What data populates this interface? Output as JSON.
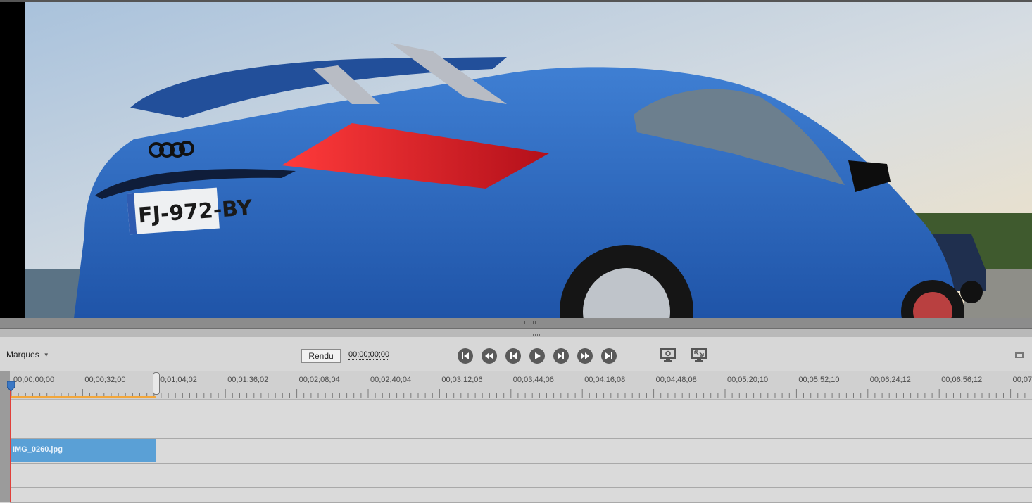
{
  "preview": {
    "plate": "FJ-972-BY",
    "scene": "photo of blue sports coupe at seaside"
  },
  "controls": {
    "markers_label": "Marques",
    "render_label": "Rendu",
    "timecode": "00;00;00;00",
    "transport_icons": [
      "go-to-start-icon",
      "previous-edit-icon",
      "step-back-icon",
      "play-icon",
      "step-forward-icon",
      "next-edit-icon",
      "go-to-end-icon"
    ],
    "monitor_icons": [
      "monitor-settings-icon",
      "fit-monitor-icon"
    ]
  },
  "timeline": {
    "ruler_labels": [
      "00;00;00;00",
      "00;00;32;00",
      "00;01;04;02",
      "00;01;36;02",
      "00;02;08;04",
      "00;02;40;04",
      "00;03;12;06",
      "00;03;44;06",
      "00;04;16;08",
      "00;04;48;08",
      "00;05;20;10",
      "00;05;52;10",
      "00;06;24;12",
      "00;06;56;12",
      "00;07;"
    ],
    "clip_name": "IMG_0260.jpg",
    "colors": {
      "clip": "#5aa0d6",
      "playhead": "#e0403a",
      "work_area": "#f2a63a"
    }
  }
}
